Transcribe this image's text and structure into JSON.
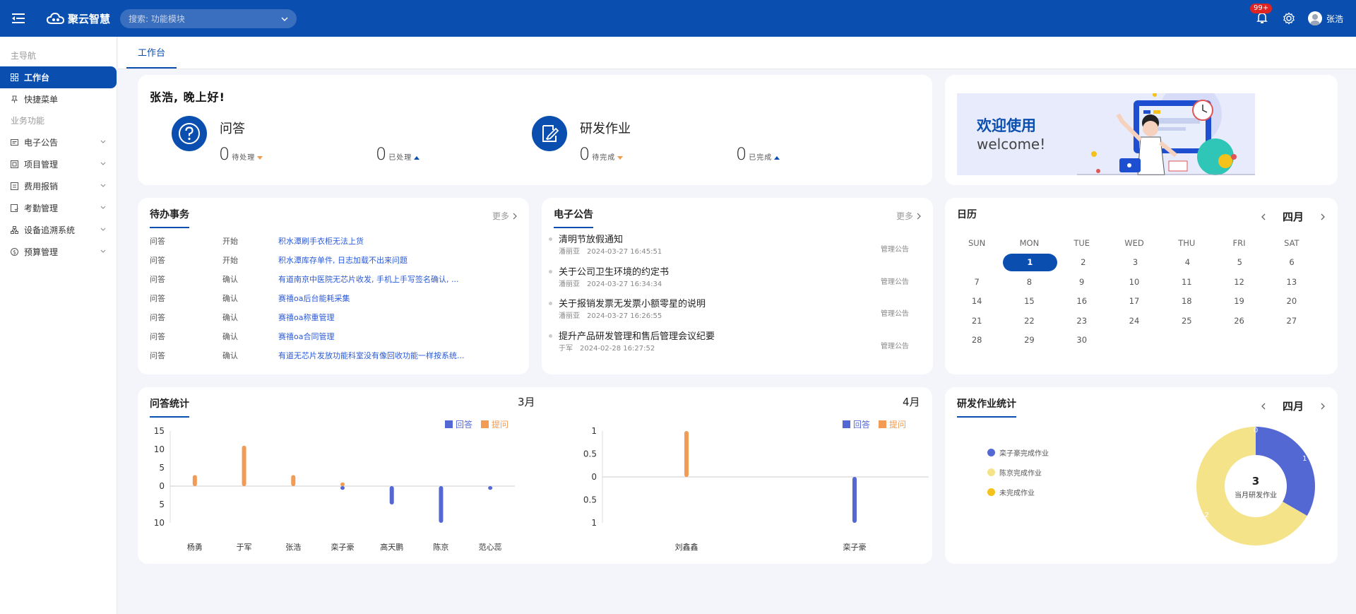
{
  "topbar": {
    "app_name": "聚云智慧",
    "search_placeholder": "搜索: 功能模块",
    "notify_badge": "99+",
    "user_name": "张浩",
    "brand_color": "#0a4fb0"
  },
  "sidebar": {
    "group_main": "主导航",
    "group_business": "业务功能",
    "items_main": [
      {
        "label": "工作台",
        "icon": "grid-icon"
      },
      {
        "label": "快捷菜单",
        "icon": "pin-icon"
      }
    ],
    "items_business": [
      {
        "label": "电子公告",
        "icon": "bulletin-icon"
      },
      {
        "label": "项目管理",
        "icon": "project-icon"
      },
      {
        "label": "费用报销",
        "icon": "expense-icon"
      },
      {
        "label": "考勤管理",
        "icon": "attendance-icon"
      },
      {
        "label": "设备追溯系统",
        "icon": "device-icon"
      },
      {
        "label": "预算管理",
        "icon": "budget-icon"
      }
    ]
  },
  "tabs": {
    "active": "工作台"
  },
  "overview": {
    "greeting": "张浩, 晚上好!",
    "qa": {
      "title": "问答",
      "pending_value": "0",
      "pending_label": "待处理",
      "done_value": "0",
      "done_label": "已处理"
    },
    "dev": {
      "title": "研发作业",
      "pending_value": "0",
      "pending_label": "待完成",
      "done_value": "0",
      "done_label": "已完成"
    }
  },
  "welcome": {
    "title": "欢迎使用",
    "subtitle": "welcome!"
  },
  "todo": {
    "title": "待办事务",
    "more": "更多",
    "rows": [
      {
        "type": "问答",
        "status": "开始",
        "content": "积水潭刷手衣柜无法上货"
      },
      {
        "type": "问答",
        "status": "开始",
        "content": "积水潭库存单件, 日志加载不出来问题"
      },
      {
        "type": "问答",
        "status": "确认",
        "content": "有道南京中医院无芯片收发, 手机上手写签名确认, ..."
      },
      {
        "type": "问答",
        "status": "确认",
        "content": "赛禧oa后台能耗采集"
      },
      {
        "type": "问答",
        "status": "确认",
        "content": "赛禧oa称重管理"
      },
      {
        "type": "问答",
        "status": "确认",
        "content": "赛禧oa合同管理"
      },
      {
        "type": "问答",
        "status": "确认",
        "content": "有道无芯片发放功能科室没有像回收功能一样按系统..."
      }
    ]
  },
  "notices": {
    "title": "电子公告",
    "more": "更多",
    "items": [
      {
        "title": "清明节放假通知",
        "author": "潘丽亚",
        "time": "2024-03-27 16:45:51",
        "category": "管理公告"
      },
      {
        "title": "关于公司卫生环境的约定书",
        "author": "潘丽亚",
        "time": "2024-03-27 16:34:34",
        "category": "管理公告"
      },
      {
        "title": "关于报销发票无发票小额零星的说明",
        "author": "潘丽亚",
        "time": "2024-03-27 16:26:55",
        "category": "管理公告"
      },
      {
        "title": "提升产品研发管理和售后管理会议纪要",
        "author": "于军",
        "time": "2024-02-28 16:27:52",
        "category": "管理公告"
      }
    ]
  },
  "calendar": {
    "title": "日历",
    "month": "四月",
    "weekdays": [
      "SUN",
      "MON",
      "TUE",
      "WED",
      "THU",
      "FRI",
      "SAT"
    ],
    "weeks": [
      [
        "",
        "1",
        "2",
        "3",
        "4",
        "5",
        "6"
      ],
      [
        "7",
        "8",
        "9",
        "10",
        "11",
        "12",
        "13"
      ],
      [
        "14",
        "15",
        "16",
        "17",
        "18",
        "19",
        "20"
      ],
      [
        "21",
        "22",
        "23",
        "24",
        "25",
        "26",
        "27"
      ],
      [
        "28",
        "29",
        "30",
        "",
        "",
        "",
        ""
      ]
    ],
    "today": "1"
  },
  "qa_stats": {
    "title": "问答统计",
    "legend_answer": "回答",
    "legend_ask": "提问",
    "colors": {
      "answer": "#5468d4",
      "ask": "#f29b54"
    }
  },
  "dev_stats": {
    "title": "研发作业统计",
    "month": "四月",
    "center_value": "3",
    "center_label": "当月研发作业",
    "legend": [
      {
        "label": "栾子豪完成作业",
        "color": "#5468d4"
      },
      {
        "label": "陈京完成作业",
        "color": "#f5e38a"
      },
      {
        "label": "未完成作业",
        "color": "#f4c21a"
      }
    ]
  },
  "chart_data": [
    {
      "type": "bar",
      "title": "3月",
      "categories": [
        "杨勇",
        "于军",
        "张浩",
        "栾子豪",
        "高天鹏",
        "陈京",
        "范心蕊"
      ],
      "series": [
        {
          "name": "提问",
          "values": [
            3,
            11,
            3,
            1,
            0,
            0,
            0
          ]
        },
        {
          "name": "回答",
          "values": [
            0,
            0,
            0,
            1,
            5,
            10,
            1
          ]
        }
      ],
      "y_ticks": [
        "15",
        "10",
        "5",
        "0",
        "5",
        "10"
      ],
      "ylim": [
        -10,
        15
      ]
    },
    {
      "type": "bar",
      "title": "4月",
      "categories": [
        "刘鑫鑫",
        "栾子豪"
      ],
      "series": [
        {
          "name": "提问",
          "values": [
            1,
            0
          ]
        },
        {
          "name": "回答",
          "values": [
            0,
            1
          ]
        }
      ],
      "y_ticks": [
        "1",
        "0.5",
        "0",
        "0.5",
        "1"
      ],
      "ylim": [
        -1,
        1
      ]
    },
    {
      "type": "pie",
      "title": "四月",
      "slices": [
        {
          "label": "栾子豪完成作业",
          "value": 1,
          "color": "#5468d4"
        },
        {
          "label": "陈京完成作业",
          "value": 2,
          "color": "#f5e38a"
        },
        {
          "label": "未完成作业",
          "value": 0,
          "color": "#f4c21a"
        }
      ],
      "slice_labels": [
        "1",
        "2",
        "0"
      ]
    }
  ]
}
